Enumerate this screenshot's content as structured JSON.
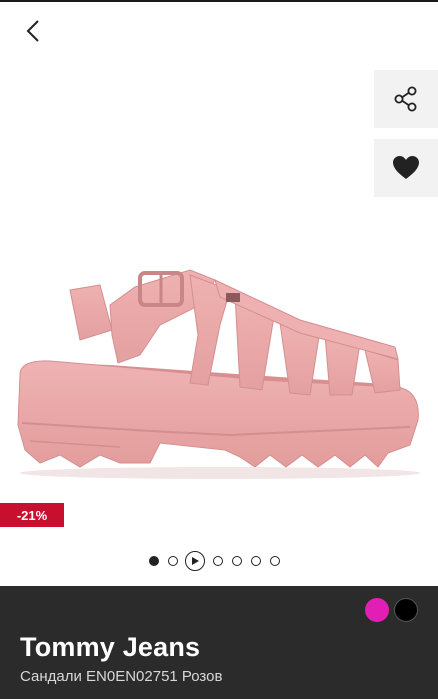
{
  "header": {
    "back_icon": "chevron-left-icon"
  },
  "actions": {
    "share_icon": "share-icon",
    "wishlist_icon": "heart-icon"
  },
  "product": {
    "discount": "-21%",
    "brand": "Tommy Jeans",
    "subtitle": "Сандали EN0EN02751 Розов",
    "colors": [
      "#e21fb4",
      "#000000"
    ]
  },
  "gallery": {
    "total_items": 7,
    "active_index": 0,
    "video_item_index": 2
  },
  "colors": {
    "panel_bg": "#2b2b2b",
    "badge_bg": "#c8102e",
    "sandal_pink": "#e9a7a7"
  }
}
